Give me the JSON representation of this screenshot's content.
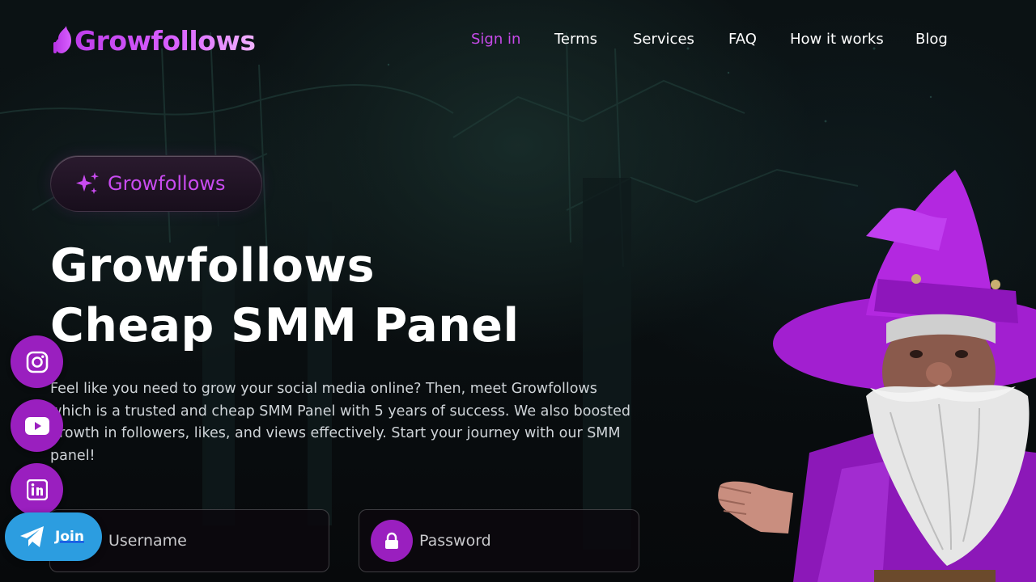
{
  "brand": {
    "logo_text": "Growfollows",
    "accent": "#c64ae8",
    "purple": "#9a1fbf",
    "telegram_blue": "#2c9de0"
  },
  "nav": {
    "items": [
      {
        "label": "Sign in",
        "active": true
      },
      {
        "label": "Terms"
      },
      {
        "label": "Services"
      },
      {
        "label": "FAQ"
      },
      {
        "label": "How it works"
      },
      {
        "label": "Blog"
      }
    ]
  },
  "hero": {
    "badge": "Growfollows",
    "title_line1": "Growfollows",
    "title_line2": "Cheap SMM Panel",
    "description": "Feel like you need to grow your social media online? Then, meet Growfollows which is a trusted and cheap SMM Panel with 5 years of success. We also boosted growth in followers, likes, and views effectively. Start your journey with our SMM panel!"
  },
  "form": {
    "username_placeholder": "Username",
    "password_placeholder": "Password"
  },
  "social": {
    "icons": [
      "instagram-icon",
      "youtube-icon",
      "linkedin-icon",
      "telegram-icon"
    ],
    "join_label": "Join"
  }
}
